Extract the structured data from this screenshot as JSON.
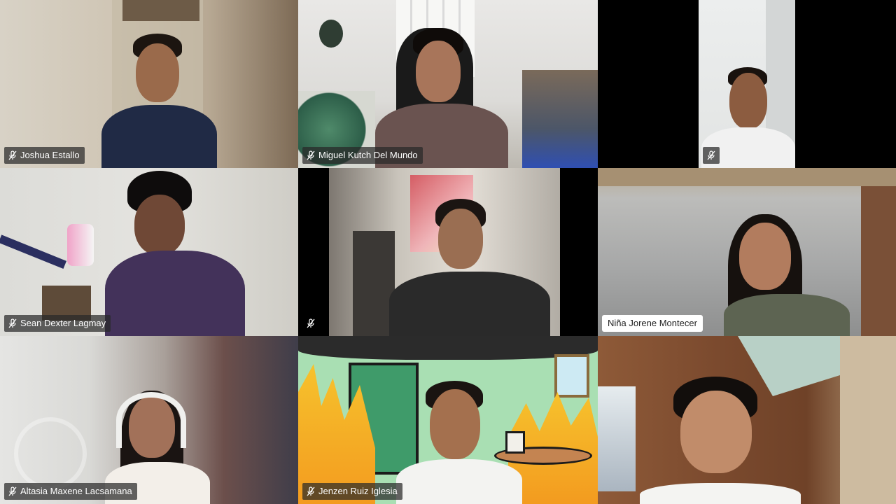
{
  "participants": [
    {
      "name": "Joshua Estallo",
      "muted": true
    },
    {
      "name": "Miguel Kutch Del Mundo",
      "muted": true
    },
    {
      "name": "",
      "muted": true
    },
    {
      "name": "Sean Dexter Lagmay",
      "muted": true
    },
    {
      "name": "",
      "muted": true
    },
    {
      "name": "Niña Jorene Montecer",
      "muted": false
    },
    {
      "name": "Altasia Maxene Lacsamana",
      "muted": true
    },
    {
      "name": "Jenzen Ruiz Iglesia",
      "muted": true
    },
    {
      "name": "",
      "muted": false
    }
  ],
  "icons": {
    "muted": "mic-muted-icon"
  },
  "colors": {
    "label_bg": "#2a2a2a",
    "label_text": "#ffffff",
    "grid_bg": "#000000"
  }
}
